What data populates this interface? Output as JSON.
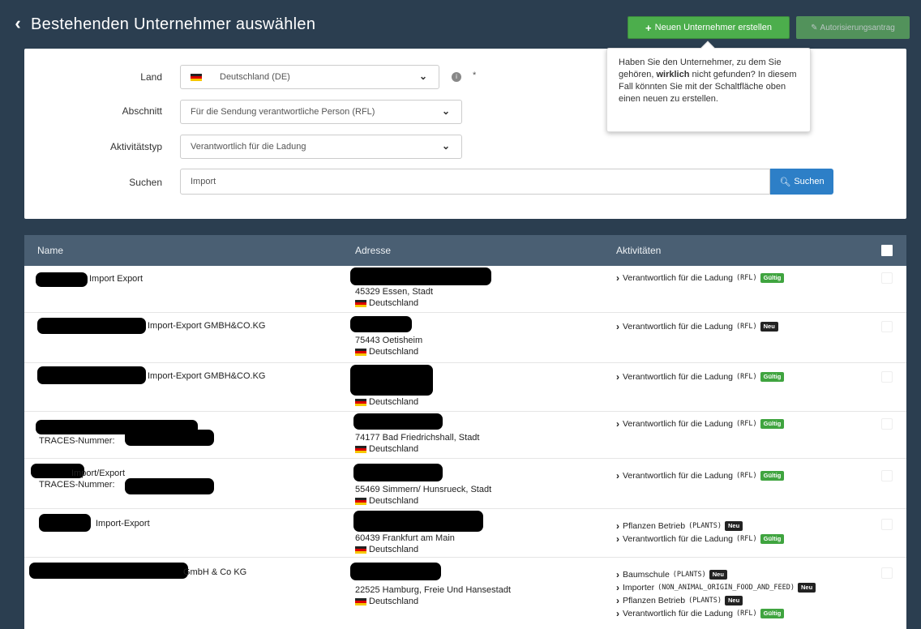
{
  "header": {
    "title": "Bestehenden Unternehmer auswählen",
    "new_button": "Neuen Unternehmer erstellen",
    "auth_button": "Autorisierungsantrag"
  },
  "tooltip": {
    "text_before": "Haben Sie den Unternehmer, zu dem Sie gehören, ",
    "emphasis": "wirklich",
    "text_after": " nicht gefunden? In diesem Fall könnten Sie mit der Schaltfläche oben einen neuen zu erstellen."
  },
  "filters": {
    "land_label": "Land",
    "land_value": "Deutschland (DE)",
    "abschnitt_label": "Abschnitt",
    "abschnitt_value": "Für die Sendung verantwortliche Person (RFL)",
    "aktivitaet_label": "Aktivitätstyp",
    "aktivitaet_value": "Verantwortlich für die Ladung",
    "search_label": "Suchen",
    "search_value": "Import",
    "search_button": "Suchen",
    "required_mark": "*"
  },
  "table": {
    "columns": [
      "Name",
      "Adresse",
      "Aktivitäten"
    ],
    "traces_label": "TRACES-Nummer:",
    "country": "Deutschland",
    "badge_valid": "Gültig",
    "badge_new": "Neu",
    "rows": [
      {
        "name": "Import Export",
        "address": "45329 Essen, Stadt",
        "activities": [
          {
            "label": "Verantwortlich für die Ladung",
            "code": "(RFL)",
            "status": "Gültig"
          }
        ]
      },
      {
        "name": "Import-Export GMBH&CO.KG",
        "address": "75443 Oetisheim",
        "activities": [
          {
            "label": "Verantwortlich für die Ladung",
            "code": "(RFL)",
            "status": "Neu"
          }
        ]
      },
      {
        "name": "Import-Export GMBH&CO.KG",
        "address": "",
        "activities": [
          {
            "label": "Verantwortlich für die Ladung",
            "code": "(RFL)",
            "status": "Gültig"
          }
        ]
      },
      {
        "name": "",
        "address": "74177 Bad Friedrichshall, Stadt",
        "activities": [
          {
            "label": "Verantwortlich für die Ladung",
            "code": "(RFL)",
            "status": "Gültig"
          }
        ]
      },
      {
        "name": "Import/Export",
        "address": "55469 Simmern/ Hunsrueck, Stadt",
        "activities": [
          {
            "label": "Verantwortlich für die Ladung",
            "code": "(RFL)",
            "status": "Gültig"
          }
        ]
      },
      {
        "name": "Import-Export",
        "address": "60439 Frankfurt am Main",
        "activities": [
          {
            "label": "Pflanzen Betrieb",
            "code": "(PLANTS)",
            "status": "Neu"
          },
          {
            "label": "Verantwortlich für die Ladung",
            "code": "(RFL)",
            "status": "Gültig"
          }
        ]
      },
      {
        "name": "GmbH & Co KG",
        "address": "22525 Hamburg, Freie Und Hansestadt",
        "activities": [
          {
            "label": "Baumschule",
            "code": "(PLANTS)",
            "status": "Neu"
          },
          {
            "label": "Importer",
            "code": "(NON_ANIMAL_ORIGIN_FOOD_AND_FEED)",
            "status": "Neu"
          },
          {
            "label": "Pflanzen Betrieb",
            "code": "(PLANTS)",
            "status": "Neu"
          },
          {
            "label": "Verantwortlich für die Ladung",
            "code": "(RFL)",
            "status": "Gültig"
          }
        ]
      }
    ]
  }
}
